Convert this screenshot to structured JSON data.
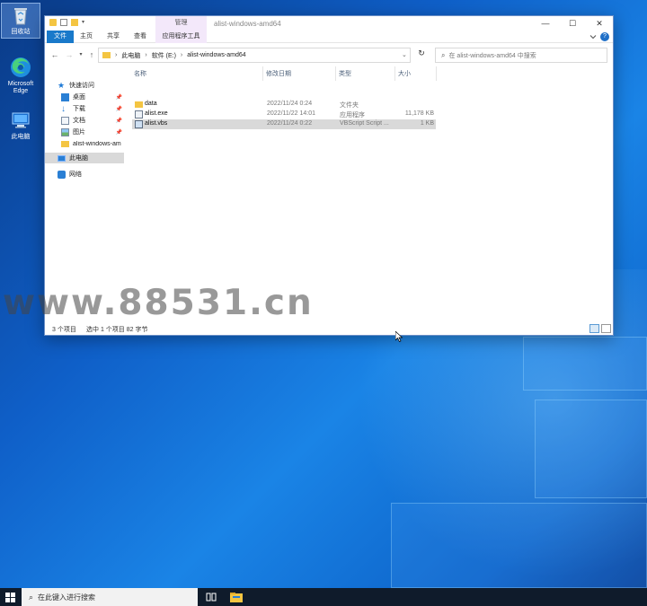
{
  "desktop": {
    "icons": [
      {
        "label": "回收站"
      },
      {
        "label": "Microsoft Edge"
      },
      {
        "label": "此电脑"
      }
    ]
  },
  "window": {
    "title": "alist-windows-amd64",
    "manage_tab": "管理",
    "controls": {
      "minimize": "—",
      "maximize": "☐",
      "close": "✕"
    }
  },
  "ribbon": {
    "tabs": [
      "文件",
      "主页",
      "共享",
      "查看",
      "应用程序工具"
    ],
    "help": "?"
  },
  "address": {
    "crumbs": [
      "此电脑",
      "软件 (E:)",
      "alist-windows-amd64"
    ],
    "search_placeholder": "在 alist-windows-amd64 中搜索"
  },
  "nav": {
    "quick_access": "快速访问",
    "items": [
      {
        "label": "桌面",
        "pinned": true
      },
      {
        "label": "下载",
        "pinned": true
      },
      {
        "label": "文档",
        "pinned": true
      },
      {
        "label": "图片",
        "pinned": true
      },
      {
        "label": "alist-windows-am",
        "pinned": false
      }
    ],
    "this_pc": "此电脑",
    "network": "网络"
  },
  "columns": {
    "name": "名称",
    "date": "修改日期",
    "type": "类型",
    "size": "大小"
  },
  "files": [
    {
      "name": "data",
      "date": "2022/11/24 0:24",
      "type": "文件夹",
      "size": "",
      "kind": "folder"
    },
    {
      "name": "alist.exe",
      "date": "2022/11/22 14:01",
      "type": "应用程序",
      "size": "11,178 KB",
      "kind": "exe"
    },
    {
      "name": "alist.vbs",
      "date": "2022/11/24 0:22",
      "type": "VBScript Script ...",
      "size": "1 KB",
      "kind": "vbs"
    }
  ],
  "status": {
    "count": "3 个项目",
    "selection": "选中 1 个项目  82 字节"
  },
  "watermark": "www.88531.cn",
  "taskbar": {
    "search_placeholder": "在此键入进行搜索"
  },
  "colors": {
    "accent": "#1979ca",
    "folder": "#f4c542",
    "selection": "#d9d9d9"
  }
}
